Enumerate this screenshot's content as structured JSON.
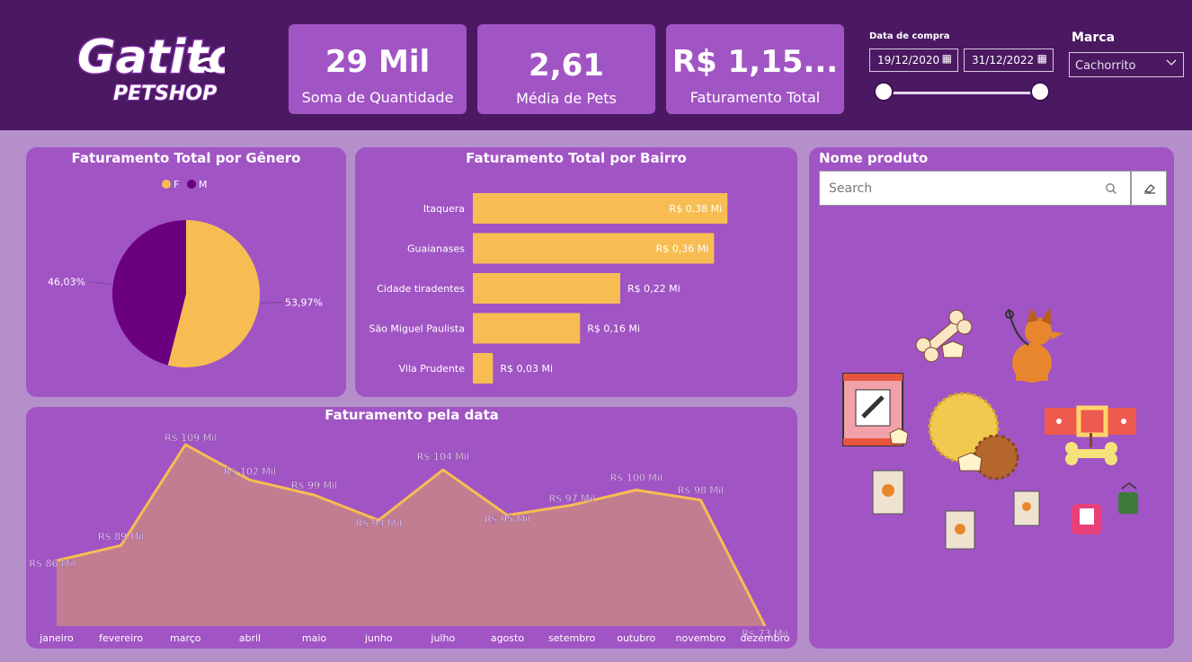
{
  "logo": {
    "line1": "Gatito",
    "line2": "PETSHOP"
  },
  "kpis": [
    {
      "value": "29 Mil",
      "label": "Soma de Quantidade"
    },
    {
      "value": "2,61",
      "label": "Média de Pets"
    },
    {
      "value": "R$ 1,15...",
      "label": "Faturamento Total"
    }
  ],
  "date_filter": {
    "label": "Data de compra",
    "start": "19/12/2020",
    "end": "31/12/2022",
    "calendar_icon": "calendar-icon",
    "range_fraction": [
      0,
      1
    ]
  },
  "brand_filter": {
    "label": "Marca",
    "selected": "Cachorrito",
    "icon": "chevron-down-icon"
  },
  "gender_card": {
    "title": "Faturamento Total por Gênero",
    "chart_data": {
      "type": "pie",
      "legend_position": "top",
      "slices": [
        {
          "name": "F",
          "value": 53.97,
          "label": "53,97%",
          "color": "#f7bd52"
        },
        {
          "name": "M",
          "value": 46.03,
          "label": "46,03%",
          "color": "#6a0080"
        }
      ]
    }
  },
  "bairro_card": {
    "title": "Faturamento Total por Bairro",
    "chart_data": {
      "type": "bar",
      "orientation": "horizontal",
      "categories": [
        "Itaquera",
        "Guaianases",
        "Cidade tiradentes",
        "São Miguel Paulista",
        "Vila Prudente"
      ],
      "values": [
        0.38,
        0.36,
        0.22,
        0.16,
        0.03
      ],
      "data_labels": [
        "R$ 0,38 Mi",
        "R$ 0,36 Mi",
        "R$ 0,22 Mi",
        "R$ 0,16 Mi",
        "R$ 0,03 Mi"
      ],
      "color": "#f7bd52"
    }
  },
  "date_card": {
    "title": "Faturamento pela data",
    "chart_data": {
      "type": "area",
      "categories": [
        "janeiro",
        "fevereiro",
        "março",
        "abril",
        "maio",
        "junho",
        "julho",
        "agosto",
        "setembro",
        "outubro",
        "novembro",
        "dezembro"
      ],
      "values": [
        86,
        89,
        109,
        102,
        99,
        94,
        104,
        95,
        97,
        100,
        98,
        73
      ],
      "data_labels": [
        "R$ 86 Mil",
        "R$ 89 Mil",
        "R$ 109 Mil",
        "R$ 102 Mil",
        "R$ 99 Mil",
        "R$ 94 Mil",
        "R$ 104 Mil",
        "R$ 95 Mil",
        "R$ 97 Mil",
        "R$ 100 Mil",
        "R$ 98 Mil",
        "R$ 73 Mil"
      ],
      "line_color": "#f7bd52",
      "fill_color": "#c27d90"
    }
  },
  "product_card": {
    "title": "Nome produto",
    "search_placeholder": "Search",
    "search_icon": "search-icon",
    "eraser_icon": "eraser-icon"
  },
  "colors": {
    "header": "#4b1962",
    "card": "#a154c4",
    "background": "#b58fca",
    "accent": "#f7bd52"
  }
}
